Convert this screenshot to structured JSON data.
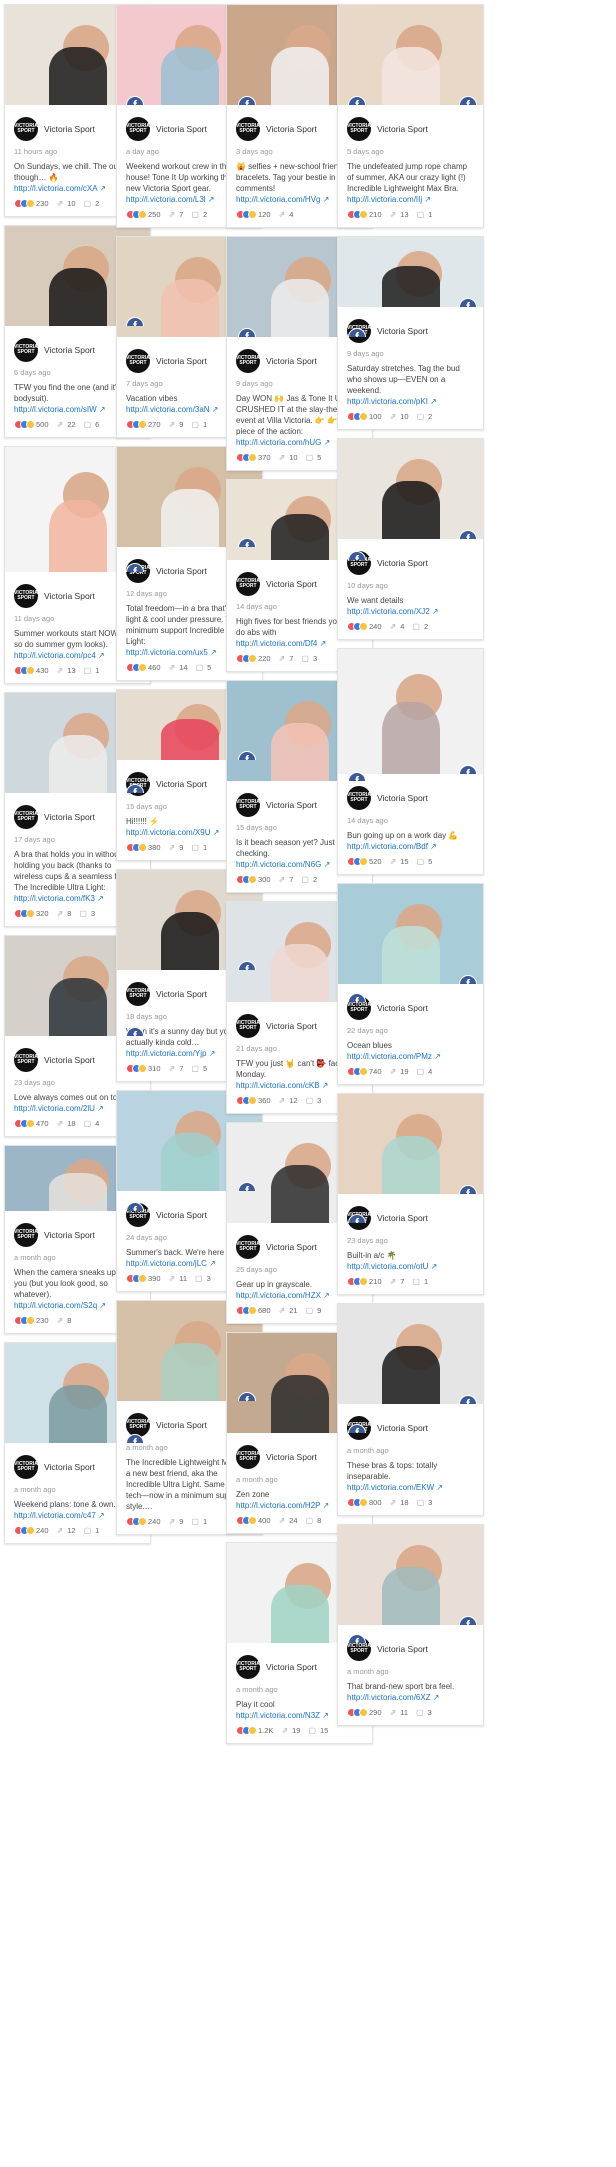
{
  "brand": {
    "author": "Victoria Sport",
    "avatar_text": "VICTORIA SPORT"
  },
  "icons": {
    "facebook": "f",
    "share": "⇗",
    "comment": "▢",
    "ext": "↗"
  },
  "columns": [
    [
      {
        "h": 100,
        "bg": "#e8e2d9",
        "body": "#1a1a1a",
        "time": "11 hours ago",
        "text": "On Sundays, we chill. The outfit though… 🔥",
        "link": "http://l.victoria.com/cXA",
        "likes": "230",
        "shares": "10",
        "comments": "2"
      },
      {
        "h": 100,
        "bg": "#d9cbbb",
        "body": "#151515",
        "time": "6 days ago",
        "text": "TFW you find the one (and it's a bodysuit).",
        "link": "http://l.victoria.com/sIW",
        "likes": "500",
        "shares": "22",
        "comments": "6"
      },
      {
        "h": 125,
        "bg": "#f4f4f4",
        "body": "#f2b5a0",
        "time": "11 days ago",
        "text": "Summer workouts start NOW (and so do summer gym looks).",
        "link": "http://l.victoria.com/pc4",
        "likes": "430",
        "shares": "13",
        "comments": "1"
      },
      {
        "h": 100,
        "bg": "#cfd9dd",
        "body": "#ececec",
        "time": "17 days ago",
        "text": "A bra that holds you in without holding you back (thanks to wireless cups & a seamless fit). The Incredible Ultra Light:",
        "link": "http://l.victoria.com/fK3",
        "likes": "320",
        "shares": "8",
        "comments": "3"
      },
      {
        "h": 100,
        "bg": "#d5d0c9",
        "body": "#2c3338",
        "time": "23 days ago",
        "text": "Love always comes out on top.",
        "link": "http://l.victoria.com/2lU",
        "likes": "470",
        "shares": "18",
        "comments": "4"
      },
      {
        "h": 65,
        "bg": "#9cb6c8",
        "body": "#e6e2dc",
        "time": "a month ago",
        "text": "When the camera sneaks up on you (but you look good, so whatever).",
        "link": "http://l.victoria.com/S2q",
        "likes": "230",
        "shares": "8",
        "comments": ""
      },
      {
        "h": 100,
        "bg": "#cfe0e6",
        "body": "#7a9aa0",
        "time": "a month ago",
        "text": "Weekend plans: tone & own.",
        "link": "http://l.victoria.com/c47",
        "likes": "240",
        "shares": "12",
        "comments": "1"
      }
    ],
    [
      {
        "h": 100,
        "bg": "#f3c9cd",
        "body": "#9bc1d4",
        "time": "a day ago",
        "text": "Weekend workout crew in the house! Tone It Up working their all-new Victoria Sport gear.",
        "link": "http://l.victoria.com/L3l",
        "likes": "250",
        "shares": "7",
        "comments": "2"
      },
      {
        "h": 100,
        "bg": "#e2d4c3",
        "body": "#f2c1b0",
        "time": "7 days ago",
        "text": "Vacation vibes",
        "link": "http://l.victoria.com/3aN",
        "likes": "270",
        "shares": "9",
        "comments": "1"
      },
      {
        "h": 100,
        "bg": "#d4c0a6",
        "body": "#f1f1f1",
        "time": "12 days ago",
        "text": "Total freedom—in a bra that's crazy light & cool under pressure. The minimum support Incredible Ultra Light:",
        "link": "http://l.victoria.com/ux5",
        "likes": "460",
        "shares": "14",
        "comments": "5"
      },
      {
        "h": 70,
        "bg": "#e7dcd0",
        "body": "#e8445a",
        "time": "15 days ago",
        "text": "Hi!!!!!! ⚡",
        "link": "http://l.victoria.com/X9U",
        "likes": "380",
        "shares": "9",
        "comments": "1"
      },
      {
        "h": 100,
        "bg": "#e0d9cf",
        "body": "#141414",
        "time": "18 days ago",
        "text": "When it's a sunny day but you're actually kinda cold…",
        "link": "http://l.victoria.com/Yjp",
        "likes": "310",
        "shares": "7",
        "comments": "5"
      },
      {
        "h": 100,
        "bg": "#b9d3e0",
        "body": "#9fd0cc",
        "time": "24 days ago",
        "text": "Summer's back. We're here for it.",
        "link": "http://l.victoria.com/jLC",
        "likes": "390",
        "shares": "11",
        "comments": "3"
      },
      {
        "h": 100,
        "bg": "#d6c0a8",
        "body": "#a9cfc2",
        "time": "a month ago",
        "text": "The Incredible Lightweight Max has a new best friend, aka the Incredible Ultra Light. Same great tech—now in a minimum support style.…",
        "link": "",
        "likes": "240",
        "shares": "9",
        "comments": "1"
      }
    ],
    [
      {
        "h": 100,
        "bg": "#caa68b",
        "body": "#f1f1f1",
        "time": "3 days ago",
        "text": "🙀 selfies + new-school friendship bracelets. Tag your bestie in the comments!",
        "link": "http://l.victoria.com/HVg",
        "likes": "120",
        "shares": "4",
        "comments": ""
      },
      {
        "h": 100,
        "bg": "#b8c7cf",
        "body": "#ececec",
        "time": "9 days ago",
        "text": "Day WON 🙌 Jas & Tone It Up CRUSHED IT at the slay-then-rosé event at Villa Victoria. 👉 👉 for a piece of the action:",
        "link": "http://l.victoria.com/hUG",
        "likes": "370",
        "shares": "10",
        "comments": "5"
      },
      {
        "h": 80,
        "bg": "#ebe2d6",
        "body": "#1d1d1d",
        "time": "14 days ago",
        "text": "High fives for best friends you can do abs with",
        "link": "http://l.victoria.com/Df4",
        "likes": "220",
        "shares": "7",
        "comments": "3"
      },
      {
        "h": 100,
        "bg": "#9fc0cf",
        "body": "#f6c2b5",
        "time": "15 days ago",
        "text": "Is it beach season yet? Just checking.",
        "link": "http://l.victoria.com/N6G",
        "likes": "300",
        "shares": "7",
        "comments": "2"
      },
      {
        "h": 100,
        "bg": "#dde3e6",
        "body": "#f0d8d0",
        "time": "21 days ago",
        "text": "TFW you just 🤘 can't 👺 face 🚪 Monday.",
        "link": "http://l.victoria.com/cKB",
        "likes": "360",
        "shares": "12",
        "comments": "3"
      },
      {
        "h": 100,
        "bg": "#ededed",
        "body": "#2a2a2a",
        "time": "25 days ago",
        "text": "Gear up in grayscale.",
        "link": "http://l.victoria.com/HZX",
        "likes": "680",
        "shares": "21",
        "comments": "9"
      },
      {
        "h": 100,
        "bg": "#c3a98f",
        "body": "#2b2b2b",
        "time": "a month ago",
        "text": "Zen zone",
        "link": "http://l.victoria.com/H2P",
        "likes": "400",
        "shares": "24",
        "comments": "8"
      },
      {
        "h": 100,
        "bg": "#f2f2f2",
        "body": "#9fd3c4",
        "time": "a month ago",
        "text": "Play it cool",
        "link": "http://l.victoria.com/N3Z",
        "likes": "1.2K",
        "shares": "19",
        "comments": "15"
      }
    ],
    [
      {
        "h": 100,
        "bg": "#e8d8c8",
        "body": "#f3e5e0",
        "time": "5 days ago",
        "text": "The undefeated jump rope champ of summer, AKA our crazy light (!) Incredible Lightweight Max Bra.",
        "link": "http://l.victoria.com/IIj",
        "likes": "210",
        "shares": "13",
        "comments": "1"
      },
      {
        "h": 70,
        "bg": "#dfe7ea",
        "body": "#1c1c1c",
        "time": "9 days ago",
        "text": "Saturday stretches. Tag the bud who shows up—EVEN on a weekend.",
        "link": "http://l.victoria.com/pKI",
        "likes": "100",
        "shares": "10",
        "comments": "2"
      },
      {
        "h": 100,
        "bg": "#e9e4de",
        "body": "#151515",
        "time": "10 days ago",
        "text": "We want details",
        "link": "http://l.victoria.com/XJ2",
        "likes": "240",
        "shares": "4",
        "comments": "2"
      },
      {
        "h": 125,
        "bg": "#f1f1f1",
        "body": "#b7a5a5",
        "time": "14 days ago",
        "text": "Bun going up on a work day 💪",
        "link": "http://l.victoria.com/Bdf",
        "likes": "520",
        "shares": "15",
        "comments": "5"
      },
      {
        "h": 100,
        "bg": "#a8ccd8",
        "body": "#bfe0d8",
        "time": "22 days ago",
        "text": "Ocean blues",
        "link": "http://l.victoria.com/PMz",
        "likes": "740",
        "shares": "19",
        "comments": "4"
      },
      {
        "h": 100,
        "bg": "#e7d3c2",
        "body": "#a9d6cf",
        "time": "23 days ago",
        "text": "Built-in a/c 🌴",
        "link": "http://l.victoria.com/otU",
        "likes": "210",
        "shares": "7",
        "comments": "1"
      },
      {
        "h": 100,
        "bg": "#e5e5e5",
        "body": "#1a1a1a",
        "time": "a month ago",
        "text": "These bras & tops: totally inseparable.",
        "link": "http://l.victoria.com/EKW",
        "likes": "800",
        "shares": "18",
        "comments": "3"
      },
      {
        "h": 100,
        "bg": "#e9ded6",
        "body": "#9fbbbd",
        "time": "a month ago",
        "text": "That brand-new sport bra feel.",
        "link": "http://l.victoria.com/6XZ",
        "likes": "290",
        "shares": "11",
        "comments": "3"
      }
    ]
  ]
}
